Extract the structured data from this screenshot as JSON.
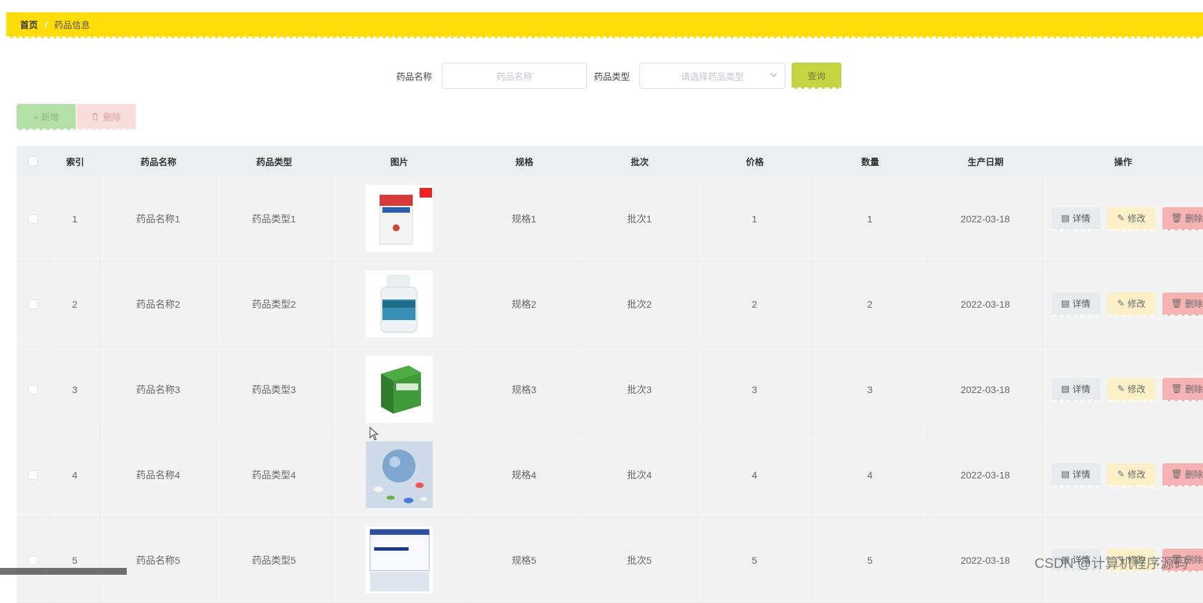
{
  "breadcrumb": {
    "home": "首页",
    "separator": "/",
    "current": "药品信息"
  },
  "search": {
    "name_label": "药品名称",
    "name_placeholder": "药品名称",
    "type_label": "药品类型",
    "type_placeholder": "请选择药品类型",
    "query_button": "查询"
  },
  "toolbar": {
    "add_label": "+ 新增",
    "delete_label": "删除"
  },
  "table": {
    "headers": [
      "索引",
      "药品名称",
      "药品类型",
      "图片",
      "规格",
      "批次",
      "价格",
      "数量",
      "生产日期",
      "操作"
    ],
    "rows": [
      {
        "index": "1",
        "name": "药品名称1",
        "type": "药品类型1",
        "spec": "规格1",
        "batch": "批次1",
        "price": "1",
        "qty": "1",
        "date": "2022-03-18"
      },
      {
        "index": "2",
        "name": "药品名称2",
        "type": "药品类型2",
        "spec": "规格2",
        "batch": "批次2",
        "price": "2",
        "qty": "2",
        "date": "2022-03-18"
      },
      {
        "index": "3",
        "name": "药品名称3",
        "type": "药品类型3",
        "spec": "规格3",
        "batch": "批次3",
        "price": "3",
        "qty": "3",
        "date": "2022-03-18"
      },
      {
        "index": "4",
        "name": "药品名称4",
        "type": "药品类型4",
        "spec": "规格4",
        "batch": "批次4",
        "price": "4",
        "qty": "4",
        "date": "2022-03-18"
      },
      {
        "index": "5",
        "name": "药品名称5",
        "type": "药品类型5",
        "spec": "规格5",
        "batch": "批次5",
        "price": "5",
        "qty": "5",
        "date": "2022-03-18"
      }
    ],
    "actions": {
      "detail": "详情",
      "edit": "修改",
      "delete": "删除"
    }
  },
  "watermark": "CSDN @计算机程序源码",
  "colors": {
    "header_bar": "#ffdd0a",
    "query": "#c5d541",
    "add": "#b4e0a7",
    "delete": "#fadede",
    "edit": "#fbf0c8",
    "row_delete": "#f7b3b3"
  }
}
